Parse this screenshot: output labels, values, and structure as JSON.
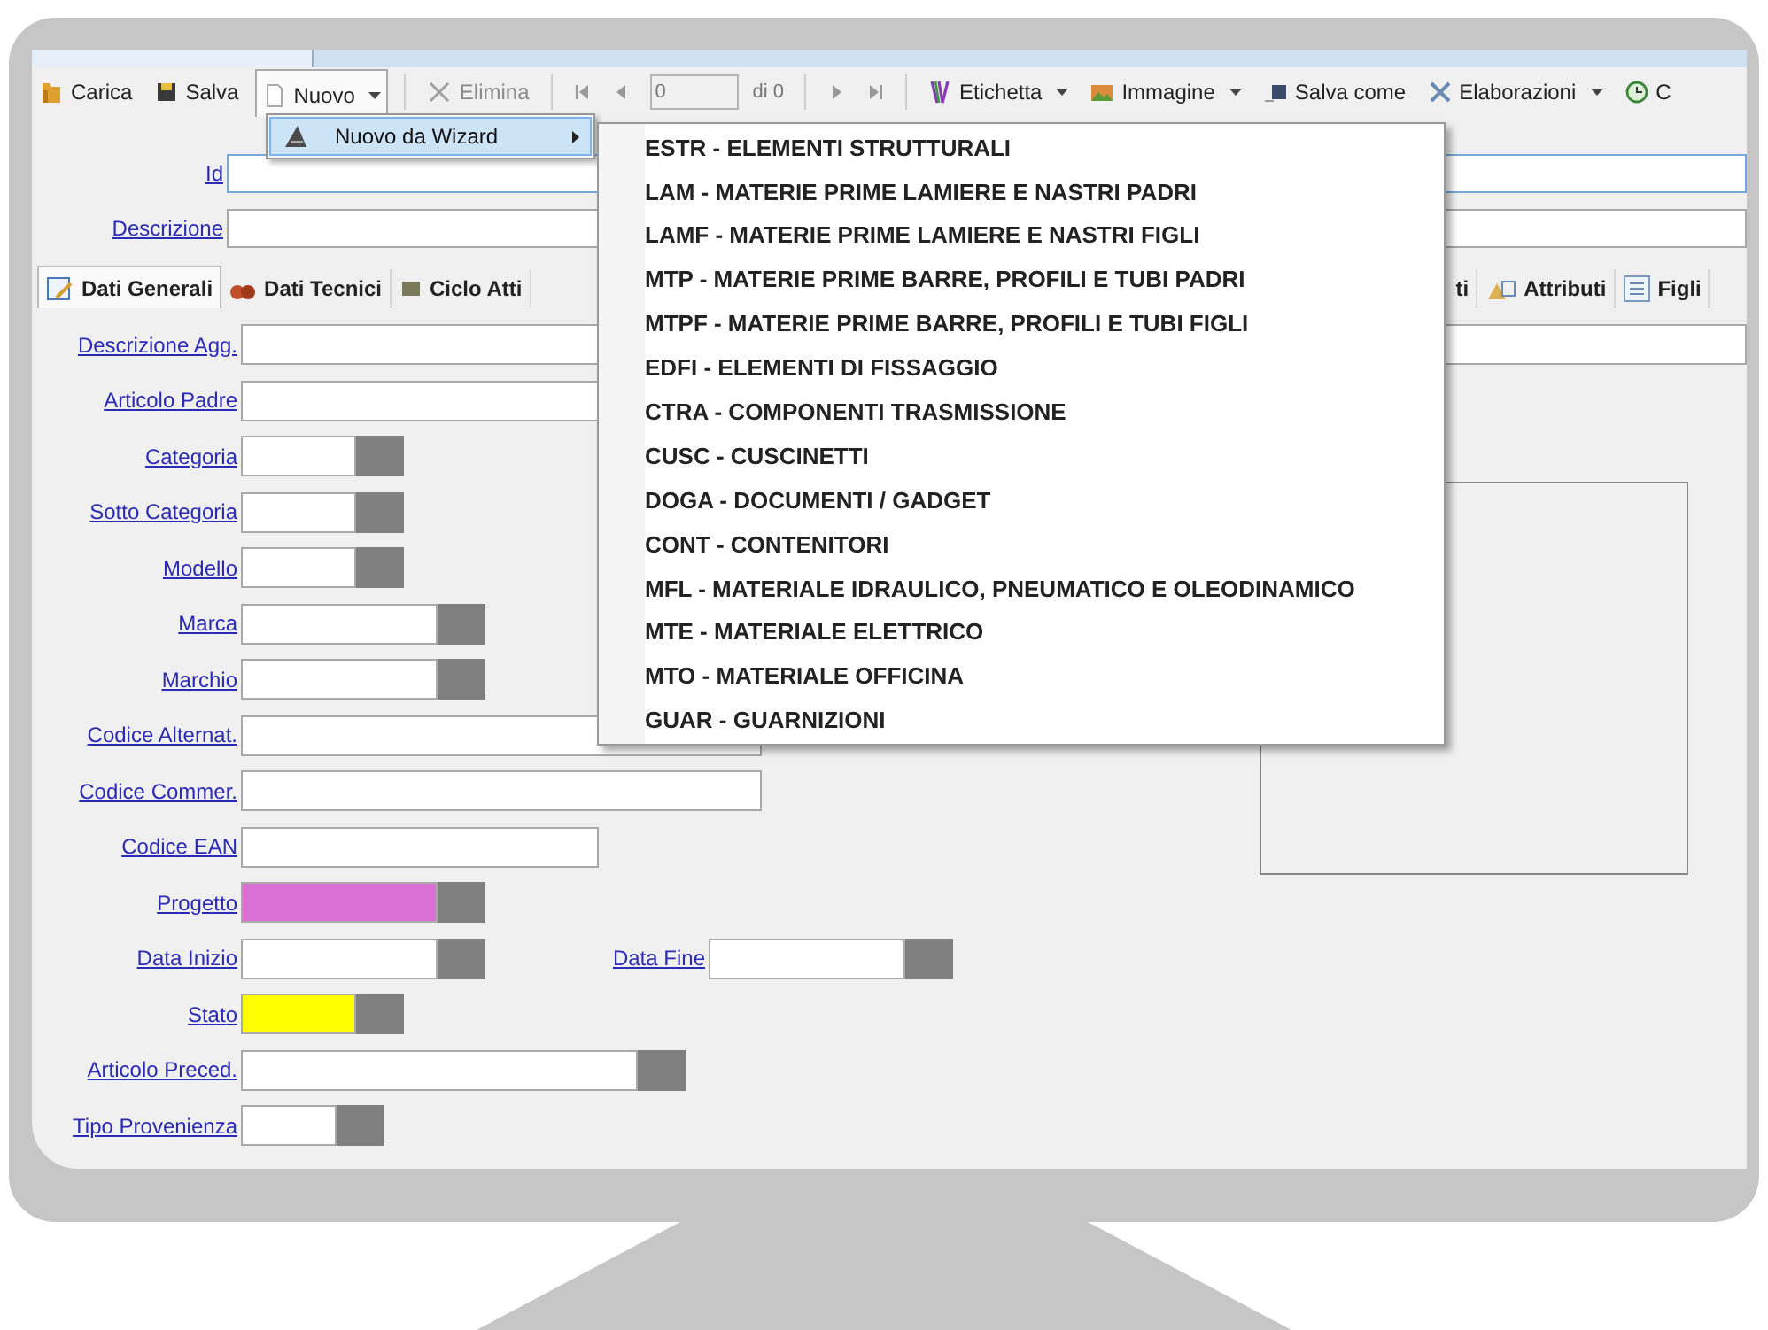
{
  "toolbar": [
    {
      "kind": "button",
      "label": "Carica",
      "disabled": false,
      "pressed": false,
      "caret": false
    },
    {
      "kind": "button",
      "label": "Salva",
      "disabled": false,
      "pressed": false,
      "caret": false
    },
    {
      "kind": "button",
      "label": "Nuovo",
      "disabled": false,
      "pressed": true,
      "caret": true
    },
    {
      "kind": "separator"
    },
    {
      "kind": "button",
      "label": "Elimina",
      "disabled": true,
      "pressed": false,
      "caret": false
    },
    {
      "kind": "separator"
    },
    {
      "kind": "nav"
    },
    {
      "kind": "nav"
    },
    {
      "kind": "counter",
      "value": "0",
      "total": "di 0"
    },
    {
      "kind": "separator"
    },
    {
      "kind": "nav"
    },
    {
      "kind": "nav"
    },
    {
      "kind": "separator"
    },
    {
      "kind": "button",
      "label": "Etichetta",
      "disabled": false,
      "pressed": false,
      "caret": true
    },
    {
      "kind": "button",
      "label": "Immagine",
      "disabled": false,
      "pressed": false,
      "caret": true
    },
    {
      "kind": "button",
      "label": "Salva come",
      "disabled": false,
      "pressed": false,
      "caret": false
    },
    {
      "kind": "button",
      "label": "Elaborazioni",
      "disabled": false,
      "pressed": false,
      "caret": true
    },
    {
      "kind": "button",
      "label": "C",
      "disabled": false,
      "pressed": false,
      "caret": false
    }
  ],
  "dropdown": {
    "items": [
      {
        "label": "Nuovo da Wizard",
        "selected": true,
        "submenu": true
      }
    ]
  },
  "submenu": {
    "items": [
      "ESTR - ELEMENTI STRUTTURALI",
      "LAM - MATERIE PRIME LAMIERE E NASTRI PADRI",
      "LAMF - MATERIE PRIME LAMIERE E NASTRI FIGLI",
      "MTP - MATERIE PRIME BARRE, PROFILI E TUBI PADRI",
      "MTPF - MATERIE PRIME BARRE, PROFILI E TUBI FIGLI",
      "EDFI - ELEMENTI DI FISSAGGIO",
      "CTRA - COMPONENTI TRASMISSIONE",
      "CUSC - CUSCINETTI",
      "DOGA - DOCUMENTI / GADGET",
      "CONT - CONTENITORI",
      "MFL - MATERIALE IDRAULICO, PNEUMATICO E OLEODINAMICO",
      "MTE - MATERIALE ELETTRICO",
      "MTO - MATERIALE OFFICINA",
      "GUAR - GUARNIZIONI"
    ]
  },
  "header": {
    "id_label": "Id",
    "description_label": "Descrizione"
  },
  "tabs": [
    {
      "label": "Dati Generali",
      "selected": true
    },
    {
      "label": "Dati Tecnici",
      "selected": false
    },
    {
      "label": "Ciclo Atti",
      "selected": false
    },
    {
      "label": "ti",
      "selected": false
    },
    {
      "label": "Attributi",
      "selected": false
    },
    {
      "label": "Figli",
      "selected": false
    }
  ],
  "fields": [
    {
      "label": "Descrizione Agg.",
      "kind": "text"
    },
    {
      "label": "Articolo Padre",
      "kind": "text"
    },
    {
      "label": "Categoria",
      "kind": "lookup"
    },
    {
      "label": "Sotto Categoria",
      "kind": "lookup"
    },
    {
      "label": "Modello",
      "kind": "lookup"
    },
    {
      "label": "Marca",
      "kind": "lookup"
    },
    {
      "label": "Marchio",
      "kind": "lookup"
    },
    {
      "label": "Codice Alternat.",
      "kind": "text"
    },
    {
      "label": "Codice Commer.",
      "kind": "text"
    },
    {
      "label": "Codice EAN",
      "kind": "text"
    },
    {
      "label": "Progetto",
      "kind": "lookup",
      "color": "#da6fd6"
    },
    {
      "label": "Data Inizio",
      "kind": "lookup",
      "second": {
        "label": "Data Fine",
        "kind": "lookup"
      }
    },
    {
      "label": "Stato",
      "kind": "lookup",
      "color": "#ffff00"
    },
    {
      "label": "Articolo Preced.",
      "kind": "lookup"
    },
    {
      "label": "Tipo Provenienza",
      "kind": "lookup"
    }
  ]
}
